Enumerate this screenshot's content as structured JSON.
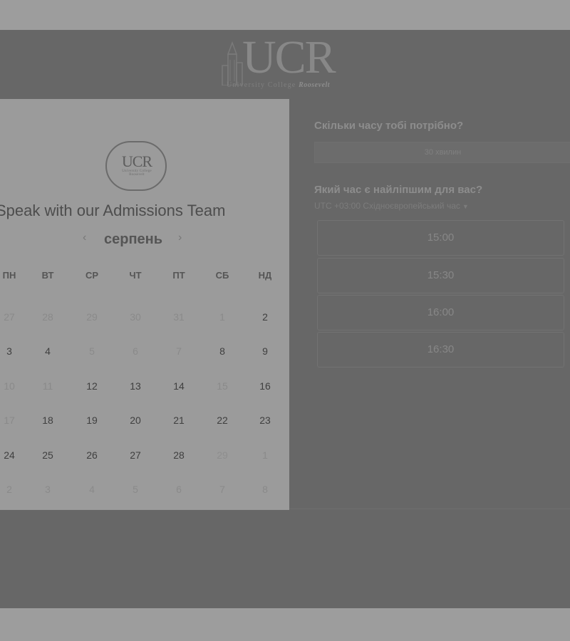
{
  "logo": {
    "text": "UCR",
    "text_accent": "R",
    "sub_prefix": "University College ",
    "sub_emphasis": "Roosevelt"
  },
  "calendar_card": {
    "badge_text": "UCR",
    "badge_sub": "University College Roosevelt",
    "title": "Speak with our Admissions Team",
    "month": "серпень",
    "prev_icon": "chevron-left-icon",
    "next_icon": "chevron-right-icon",
    "weekdays": [
      "ПН",
      "ВТ",
      "СР",
      "ЧТ",
      "ПТ",
      "СБ",
      "НД"
    ],
    "weeks": [
      [
        {
          "d": "27",
          "m": true
        },
        {
          "d": "28",
          "m": true
        },
        {
          "d": "29",
          "m": true
        },
        {
          "d": "30",
          "m": true
        },
        {
          "d": "31",
          "m": true
        },
        {
          "d": "1",
          "m": true
        },
        {
          "d": "2",
          "m": false
        }
      ],
      [
        {
          "d": "3",
          "m": false
        },
        {
          "d": "4",
          "m": false
        },
        {
          "d": "5",
          "m": true
        },
        {
          "d": "6",
          "m": true
        },
        {
          "d": "7",
          "m": true
        },
        {
          "d": "8",
          "m": false
        },
        {
          "d": "9",
          "m": false
        }
      ],
      [
        {
          "d": "10",
          "m": true
        },
        {
          "d": "11",
          "m": true
        },
        {
          "d": "12",
          "m": false
        },
        {
          "d": "13",
          "m": false
        },
        {
          "d": "14",
          "m": false
        },
        {
          "d": "15",
          "m": true
        },
        {
          "d": "16",
          "m": false
        }
      ],
      [
        {
          "d": "17",
          "m": true
        },
        {
          "d": "18",
          "m": false
        },
        {
          "d": "19",
          "m": false
        },
        {
          "d": "20",
          "m": false
        },
        {
          "d": "21",
          "m": false
        },
        {
          "d": "22",
          "m": false
        },
        {
          "d": "23",
          "m": false
        }
      ],
      [
        {
          "d": "24",
          "m": false
        },
        {
          "d": "25",
          "m": false
        },
        {
          "d": "26",
          "m": false
        },
        {
          "d": "27",
          "m": false
        },
        {
          "d": "28",
          "m": false
        },
        {
          "d": "29",
          "m": false,
          "selected": true
        },
        {
          "d": "1",
          "m": true
        }
      ],
      [
        {
          "d": "2",
          "m": true
        },
        {
          "d": "3",
          "m": true
        },
        {
          "d": "4",
          "m": true
        },
        {
          "d": "5",
          "m": true
        },
        {
          "d": "6",
          "m": true
        },
        {
          "d": "7",
          "m": true
        },
        {
          "d": "8",
          "m": true
        }
      ]
    ]
  },
  "booking": {
    "duration_question": "Скільки часу тобі потрібно?",
    "duration_value": "30 хвилин",
    "time_question": "Який час є найліпшим для вас?",
    "timezone": "UTC +03:00 Східноєвропейський час",
    "timezone_icon": "caret-down-icon",
    "slots": [
      "15:00",
      "15:30",
      "16:00",
      "16:30"
    ]
  }
}
